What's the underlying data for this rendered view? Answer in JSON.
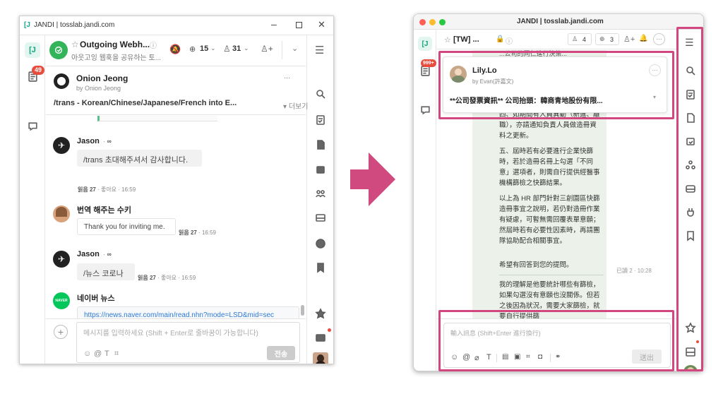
{
  "left": {
    "title": "JANDI | tosslab.jandi.com",
    "topic": {
      "name": "Outgoing Webh...",
      "desc": "아웃고잉 웹훅을 공유하는 토...",
      "members": "15",
      "members2": "31"
    },
    "card": {
      "name": "Onion Jeong",
      "by": "by Onion Jeong",
      "command": "/trans - Korean/Chinese/Japanese/French into E...",
      "more": "더보기",
      "more_dots": "..."
    },
    "partial_text": "...",
    "messages": [
      {
        "name": "Jason",
        "bot": "bot",
        "text": "/trans 초대해주셔서 감사합니다.",
        "read": "읽음 27",
        "like": "좋아요",
        "time": "16:59"
      },
      {
        "name": "번역 해주는 수키",
        "text": "Thank you for inviting me.",
        "read": "읽음 27",
        "time": "16:59"
      },
      {
        "name": "Jason",
        "bot": "bot",
        "text": "/뉴스 코로나",
        "read": "읽음 27",
        "like": "좋아요",
        "time": "16:59"
      },
      {
        "name": "네이버 뉴스",
        "avatar_text": "NAVER",
        "link": "https://news.naver.com/main/read.nhn?mode=LSD&mid=sec"
      }
    ],
    "input_placeholder": "메시지를 입력하세요 (Shift + Enter로 줄바꿈이 가능합니다)",
    "send": "전송",
    "badge": "49",
    "logo": "[J"
  },
  "right": {
    "title": "JANDI | tosslab.jandi.com",
    "topic": "[TW] ...",
    "counts": {
      "members": "4",
      "webhooks": "3"
    },
    "badge": "999+",
    "logo": "[J",
    "card": {
      "name": "Lily.Lo",
      "by": "by Evan(許嘉文)",
      "text": "**公司發票資訊** 公司抬頭：韓商青地股份有限...",
      "more_dots": "···"
    },
    "msg_top_partial": "...公司的同仁進行決策...",
    "paragraphs": [
      "四、如期間有人員異動（新進、離職），亦請通知負責人員做造冊資料之更新。",
      "五、屆時若有必要進行企業快篩時，若於造冊名冊上勾選「不同意」選項者，則需自行提供經醫事機構篩檢之快篩結果。",
      "以上為 HR 部門針對三創園區快篩造冊事宜之說明，若仍對造冊作業有疑慮，可暫無需回覆表單意願；然屆時若有必要性因素時，再請團隊協助配合相關事宜。",
      "希望有回答到您的提問。"
    ],
    "read": "已讀 2",
    "time": "10:28",
    "paragraph2": "我的理解是他要統計哪些有篩檢，如果勾選沒有意願也沒關係。但若之後因為狀況，需要大家篩檢，就要自行提供篩",
    "after_line": "告。",
    "input_placeholder": "輸入訊息 (Shift+Enter 進行換行)",
    "send": "送出",
    "bottom_partial": "...方式有..."
  }
}
